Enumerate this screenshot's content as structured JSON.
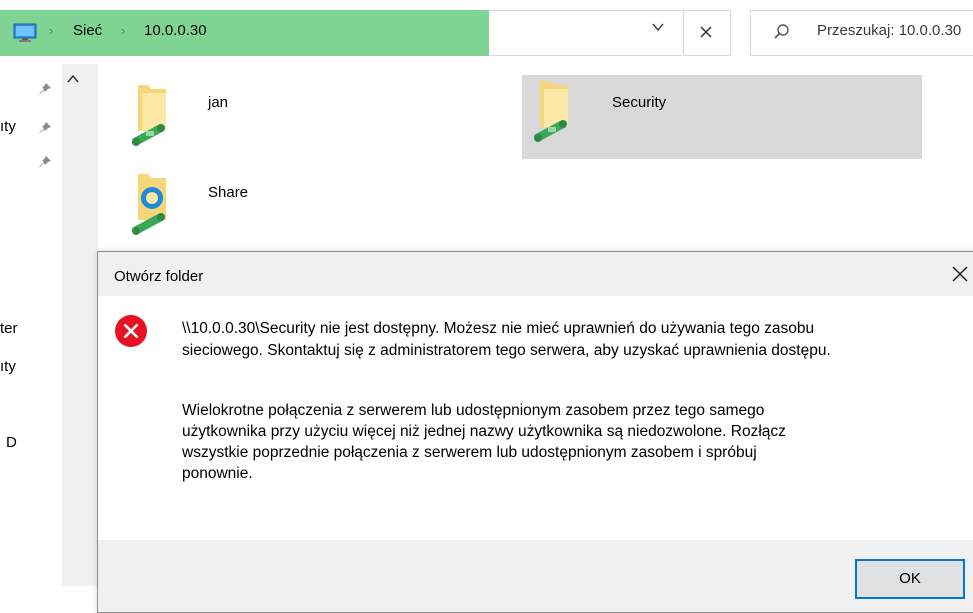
{
  "address": {
    "crumbs": [
      "Sieć",
      "10.0.0.30"
    ],
    "search_placeholder": "Przeszukaj: 10.0.0.30"
  },
  "nav_fragments": [
    "ıty",
    "ter",
    "ıty",
    "D"
  ],
  "items": [
    {
      "name": "jan",
      "type": "share"
    },
    {
      "name": "Security",
      "type": "share",
      "selected": true
    },
    {
      "name": "Share",
      "type": "share-special"
    }
  ],
  "dialog": {
    "title": "Otwórz folder",
    "message_line1": "\\\\10.0.0.30\\Security nie jest dostępny. Możesz nie mieć uprawnień do używania tego zasobu",
    "message_line2": "sieciowego. Skontaktuj się z administratorem tego serwera, aby uzyskać uprawnienia dostępu.",
    "detail_lines": [
      "Wielokrotne połączenia z serwerem lub udostępnionym zasobem przez tego samego",
      "użytkownika przy użyciu więcej niż jednej nazwy użytkownika są niedozwolone. Rozłącz",
      "wszystkie poprzednie połączenia z serwerem lub udostępnionym zasobem i spróbuj",
      "ponownie."
    ],
    "ok_label": "OK",
    "icon": "error-icon"
  },
  "colors": {
    "address_progress": "#7fd493",
    "selection": "#d9d9d9",
    "dialog_bg": "#f0f0f0",
    "error_red": "#e81123",
    "focus_border": "#0078d7"
  }
}
